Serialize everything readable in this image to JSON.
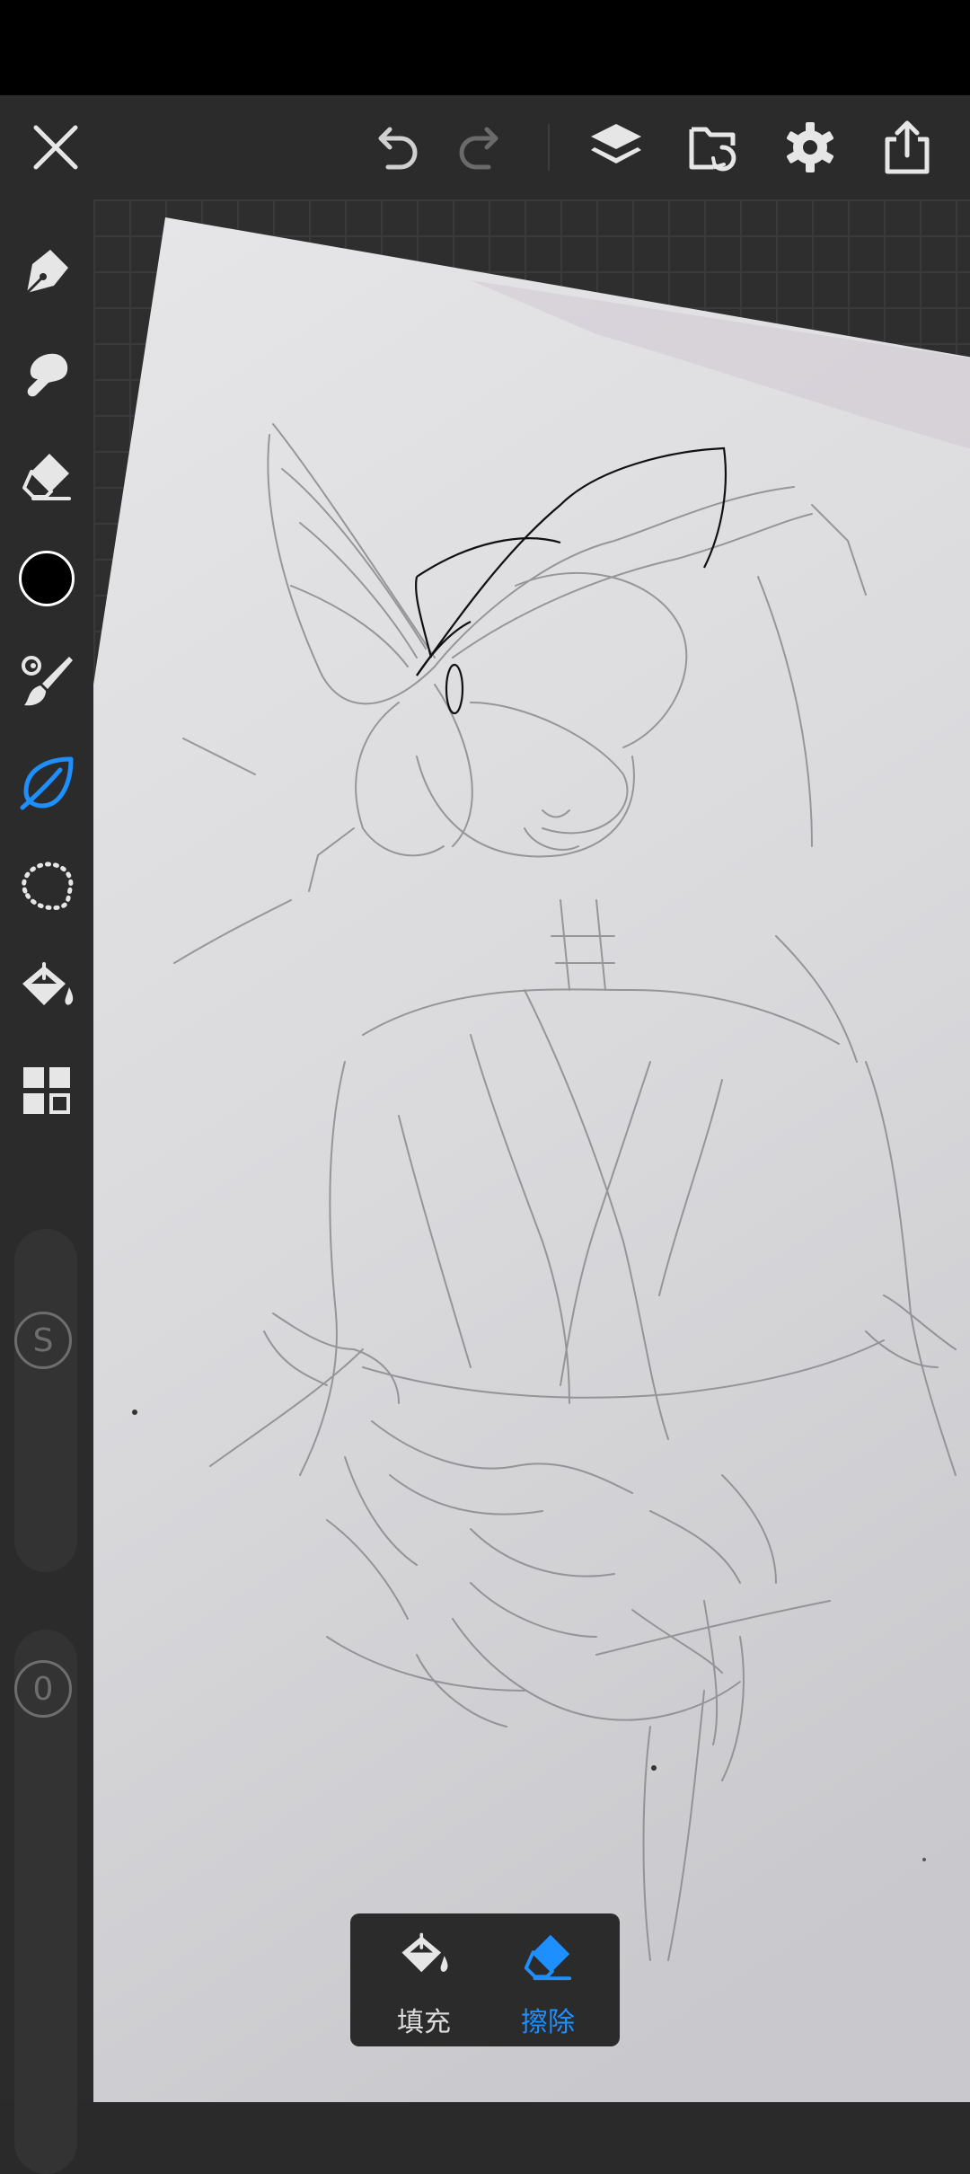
{
  "toolbar": {
    "close_icon": "close-icon",
    "undo_icon": "undo-icon",
    "redo_icon": "redo-icon",
    "layers_icon": "layers-icon",
    "import_icon": "import-image-icon",
    "settings_icon": "gear-icon",
    "share_icon": "share-icon"
  },
  "tools": [
    "pen-tool",
    "smudge-tool",
    "eraser-tool",
    "color-swatch",
    "brush-settings",
    "lasso-fill-tool",
    "selection-tool",
    "fill-bucket-tool",
    "more-tools"
  ],
  "active_tool": "lasso-fill-tool",
  "current_color": "#000000",
  "accent_color": "#1e8fff",
  "size_slider": {
    "label": "S"
  },
  "opacity_slider": {
    "label": "0"
  },
  "lasso_mode": {
    "fill_label": "填充",
    "erase_label": "擦除",
    "selected": "erase"
  }
}
